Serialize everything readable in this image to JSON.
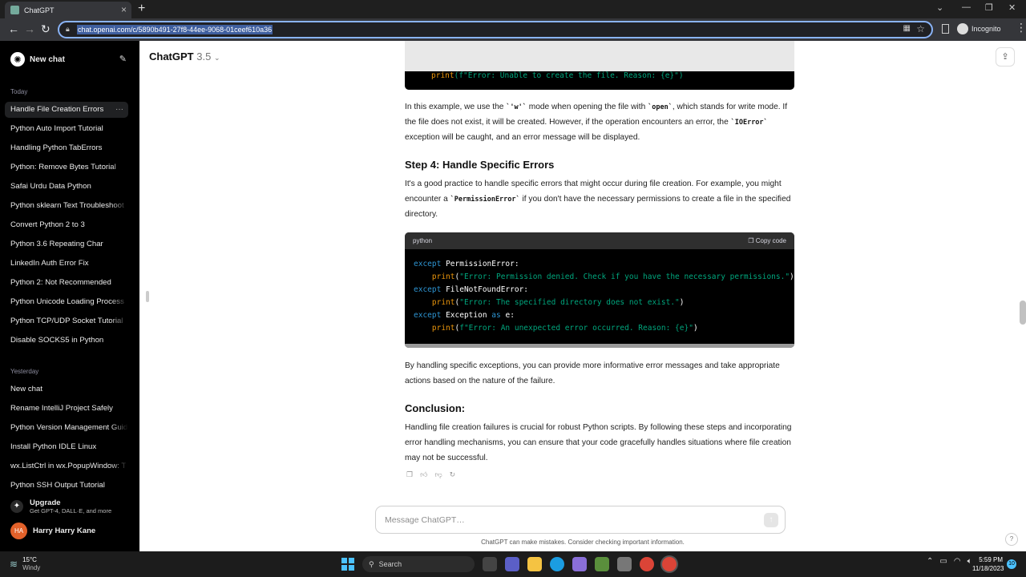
{
  "browser": {
    "tab_title": "ChatGPT",
    "url": "chat.openai.com/c/5890b491-27f8-44ee-9068-01ceef610a36",
    "profile": "Incognito"
  },
  "sidebar": {
    "new_chat": "New chat",
    "today_label": "Today",
    "today_items": [
      "Handle File Creation Errors",
      "Python Auto Import Tutorial",
      "Handling Python TabErrors",
      "Python: Remove Bytes Tutorial",
      "Safai Urdu Data Python",
      "Python sklearn Text Troubleshoot",
      "Convert Python 2 to 3",
      "Python 3.6 Repeating Char",
      "LinkedIn Auth Error Fix",
      "Python 2: Not Recommended",
      "Python Unicode Loading Process",
      "Python TCP/UDP Socket Tutorial",
      "Disable SOCKS5 in Python"
    ],
    "yesterday_label": "Yesterday",
    "yesterday_items": [
      "New chat",
      "Rename IntelliJ Project Safely",
      "Python Version Management Guide",
      "Install Python IDLE Linux",
      "wx.ListCtrl in wx.PopupWindow: T",
      "Python SSH Output Tutorial"
    ],
    "upgrade_title": "Upgrade",
    "upgrade_sub": "Get GPT-4, DALL·E, and more",
    "user_initials": "HA",
    "user_name": "Harry Harry Kane"
  },
  "header": {
    "model": "ChatGPT",
    "version": "3.5"
  },
  "content": {
    "code_top_line": "print(f\"Error: Unable to create the file. Reason: {e}\")",
    "para1": {
      "a": "In this example, we use the ",
      "b": "'w'",
      "c": " mode when opening the file with ",
      "d": "open",
      "e": ", which stands for write mode. If the file does not exist, it will be created. However, if the operation encounters an error, the ",
      "f": "IOError",
      "g": " exception will be caught, and an error message will be displayed."
    },
    "step4": "Step 4: Handle Specific Errors",
    "para2": {
      "a": "It's a good practice to handle specific errors that might occur during file creation. For example, you might encounter a ",
      "b": "PermissionError",
      "c": " if you don't have the necessary permissions to create a file in the specified directory."
    },
    "code_lang": "python",
    "copy_code": "Copy code",
    "code": {
      "kw_except": "except",
      "kw_as": "as",
      "fn_print": "print",
      "perm_err": "PermissionError:",
      "perm_msg": "\"Error: Permission denied. Check if you have the necessary permissions.\"",
      "fnf_err": "FileNotFoundError:",
      "fnf_msg": "\"Error: The specified directory does not exist.\"",
      "exc": "Exception",
      "exc_var": "e:",
      "exc_msg": "f\"Error: An unexpected error occurred. Reason: {e}\""
    },
    "para3": "By handling specific exceptions, you can provide more informative error messages and take appropriate actions based on the nature of the failure.",
    "conclusion_title": "Conclusion:",
    "para4": "Handling file creation failures is crucial for robust Python scripts. By following these steps and incorporating error handling mechanisms, you can ensure that your code gracefully handles situations where file creation may not be successful."
  },
  "composer": {
    "placeholder": "Message ChatGPT…",
    "disclaimer": "ChatGPT can make mistakes. Consider checking important information."
  },
  "taskbar": {
    "temp": "15°C",
    "weather": "Windy",
    "search": "Search",
    "time": "5:59 PM",
    "date": "11/18/2023",
    "notifications": "10"
  },
  "colors": {
    "sidebar_bg": "#000000",
    "keyword": "#2e95d3",
    "function": "#e9950c",
    "string": "#00a67d",
    "avatar": "#e2612a"
  }
}
